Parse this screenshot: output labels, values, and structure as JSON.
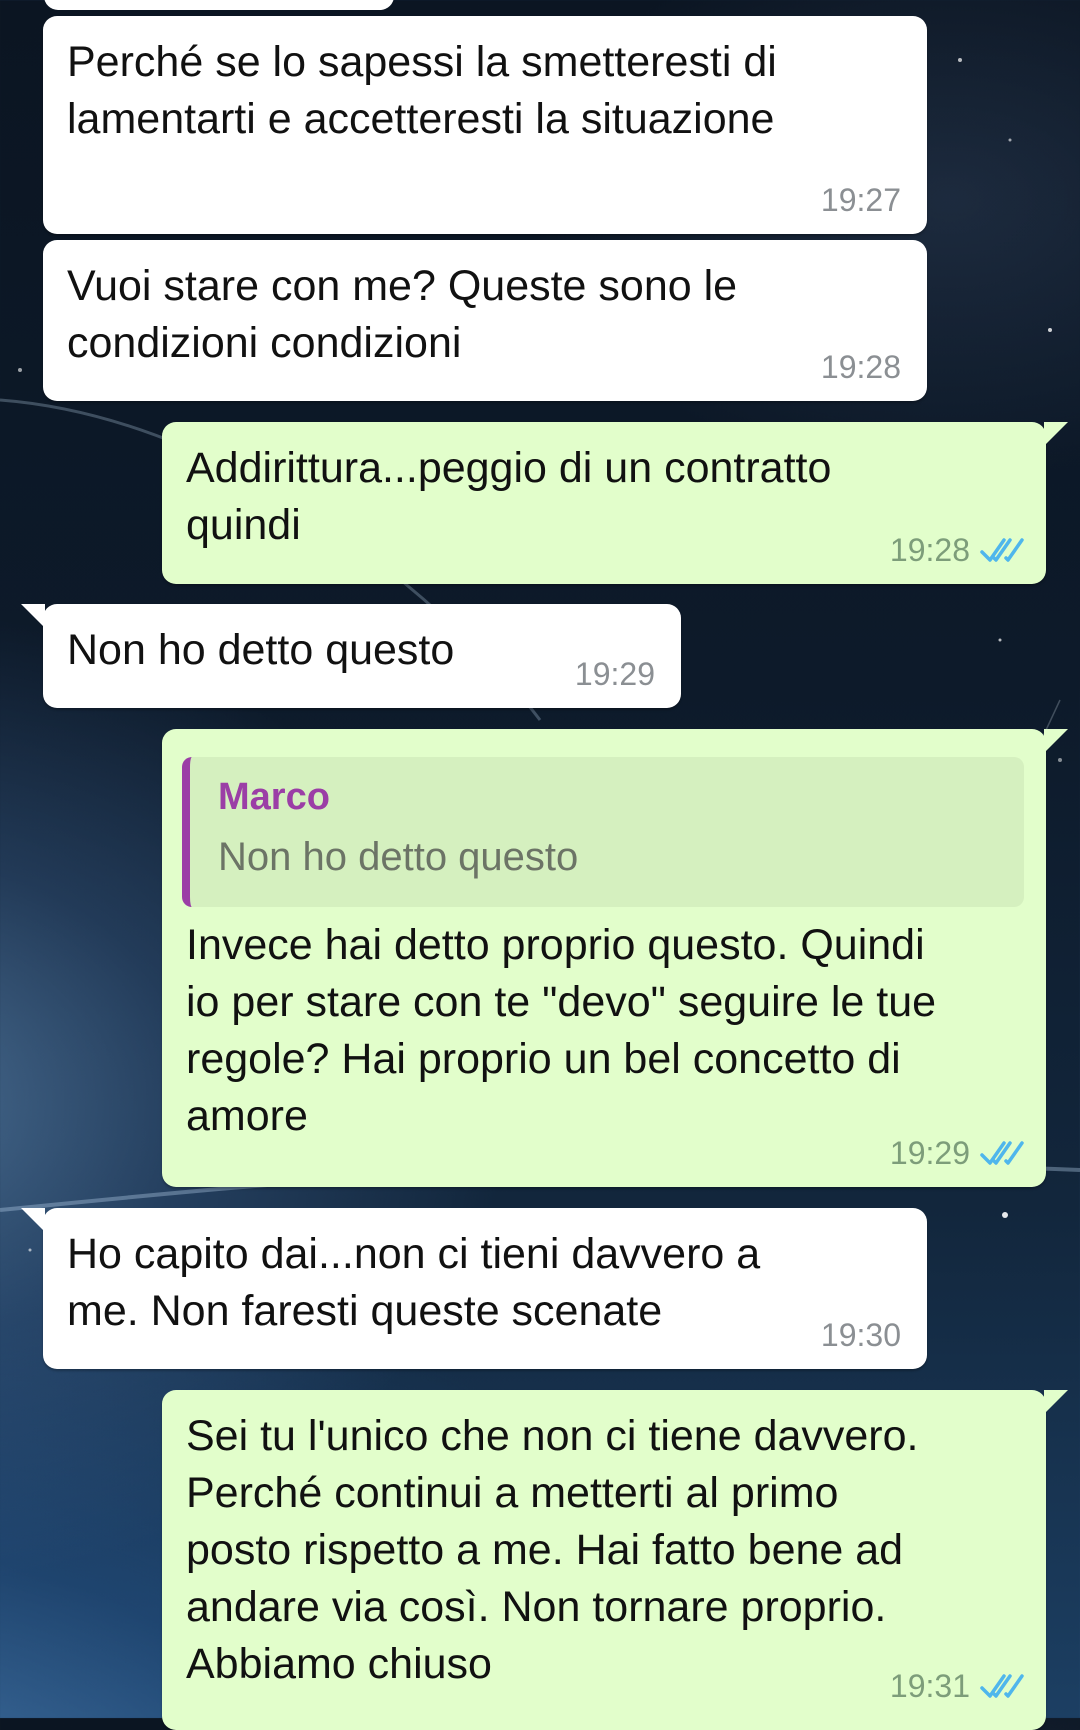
{
  "messages": [
    {
      "direction": "incoming",
      "text": "Perché se lo sapessi la smetteresti di\nlamentarti e accetteresti la situazione",
      "time": "19:27"
    },
    {
      "direction": "incoming",
      "text": "Vuoi stare con me? Queste sono le\ncondizioni condizioni",
      "time": "19:28"
    },
    {
      "direction": "outgoing",
      "text": "Addirittura...peggio di un contratto\nquindi",
      "time": "19:28",
      "status": "read"
    },
    {
      "direction": "incoming",
      "text": "Non ho detto questo",
      "time": "19:29"
    },
    {
      "direction": "outgoing",
      "quote": {
        "author": "Marco",
        "text": "Non ho detto questo"
      },
      "text": "Invece hai detto proprio questo. Quindi\nio per stare con te \"devo\" seguire le tue\nregole? Hai proprio un bel concetto di\namore",
      "time": "19:29",
      "status": "read"
    },
    {
      "direction": "incoming",
      "text": "Ho capito dai...non ci tieni davvero a\nme. Non faresti queste scenate",
      "time": "19:30"
    },
    {
      "direction": "outgoing",
      "text": "Sei tu l'unico che non ci tiene davvero.\nPerché continui a metterti al primo\nposto rispetto a me. Hai fatto bene ad\nandare via così. Non tornare proprio.\nAbbiamo chiuso",
      "time": "19:31",
      "status": "read"
    }
  ],
  "colors": {
    "incoming_bubble": "#ffffff",
    "outgoing_bubble": "#e2fecb",
    "read_ticks": "#4fb6ec",
    "quote_accent": "#9b3ea6"
  },
  "icons": {
    "read_status": "double-check-icon"
  }
}
